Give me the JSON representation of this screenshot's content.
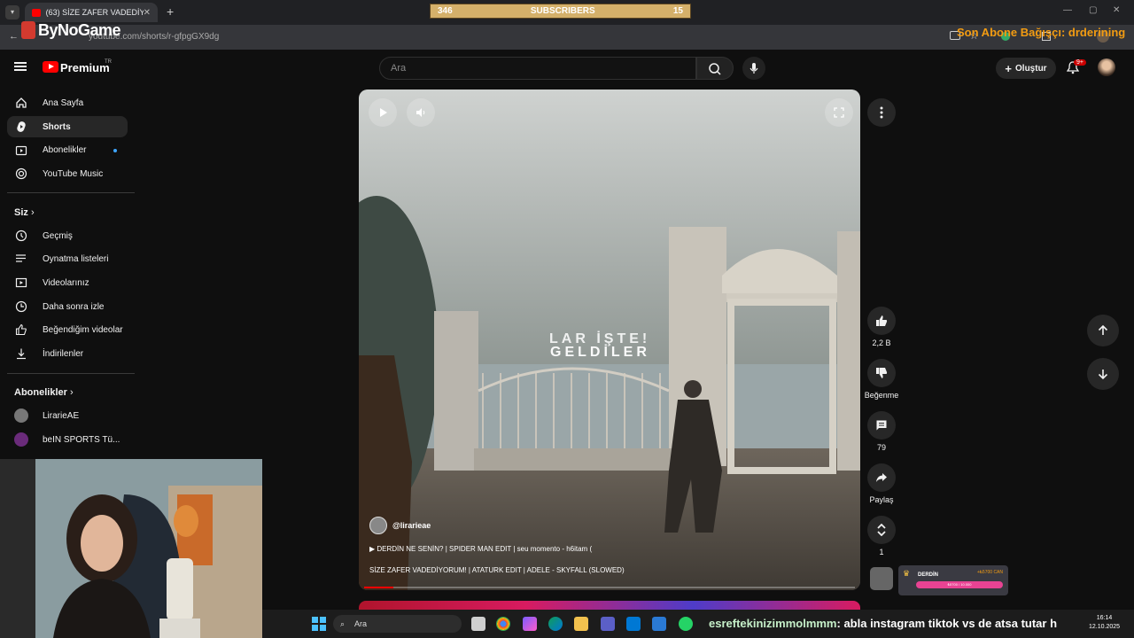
{
  "browser": {
    "tab_title": "(63) SİZE ZAFER VADEDİYORUM...",
    "url": "youtube.com/shorts/r-gfpgGX9dg"
  },
  "overlay": {
    "subs_left": "346",
    "subs_label": "SUBSCRIBERS",
    "subs_right": "15",
    "brand": "ByNoGame",
    "last_sub_text": "Son Abone Bağışçı: drderining"
  },
  "header": {
    "brand": "Premium",
    "region": "TR",
    "search_placeholder": "Ara",
    "create_label": "Oluştur",
    "notif_count": "9+"
  },
  "sidebar": {
    "main": [
      {
        "label": "Ana Sayfa",
        "icon": "home-icon"
      },
      {
        "label": "Shorts",
        "icon": "shorts-icon"
      },
      {
        "label": "Abonelikler",
        "icon": "subscriptions-icon"
      },
      {
        "label": "YouTube Music",
        "icon": "music-icon"
      }
    ],
    "you_heading": "Siz",
    "you": [
      {
        "label": "Geçmiş",
        "icon": "history-icon"
      },
      {
        "label": "Oynatma listeleri",
        "icon": "playlist-icon"
      },
      {
        "label": "Videolarınız",
        "icon": "your-videos-icon"
      },
      {
        "label": "Daha sonra izle",
        "icon": "watch-later-icon"
      },
      {
        "label": "Beğendiğim videolar",
        "icon": "liked-icon"
      },
      {
        "label": "İndirilenler",
        "icon": "download-icon"
      }
    ],
    "subs_heading": "Abonelikler",
    "subs": [
      {
        "label": "LirarieAE"
      },
      {
        "label": "beIN SPORTS Tü..."
      }
    ]
  },
  "video": {
    "channel": "@lirarieae",
    "line1": "DERDİN NE SENİN? | SPIDER MAN EDIT | seu momento - h6itam (",
    "line2": "SİZE ZAFER VADEDİYORUM! | ATATURK EDIT | ADELE - SKYFALL (SLOWED)",
    "overlay_line1": "LAR İŞTE!",
    "overlay_line2": "GELDİLER",
    "progress": 0.06
  },
  "actions": {
    "likes": "2,2 B",
    "dislike_label": "Beğenme",
    "comments": "79",
    "share_label": "Paylaş",
    "remix": "1"
  },
  "donation": {
    "title": "DERDİN",
    "amount": "+₺5700 CAN",
    "bar_text": "₺5700 / 10.000"
  },
  "taskbar": {
    "search": "Ara",
    "ticker_name": "esreftekinizimmolmmm",
    "ticker_text": ": abla instagram tiktok vs de atsa tutar h",
    "time": "16:14",
    "date": "12.10.2025"
  }
}
